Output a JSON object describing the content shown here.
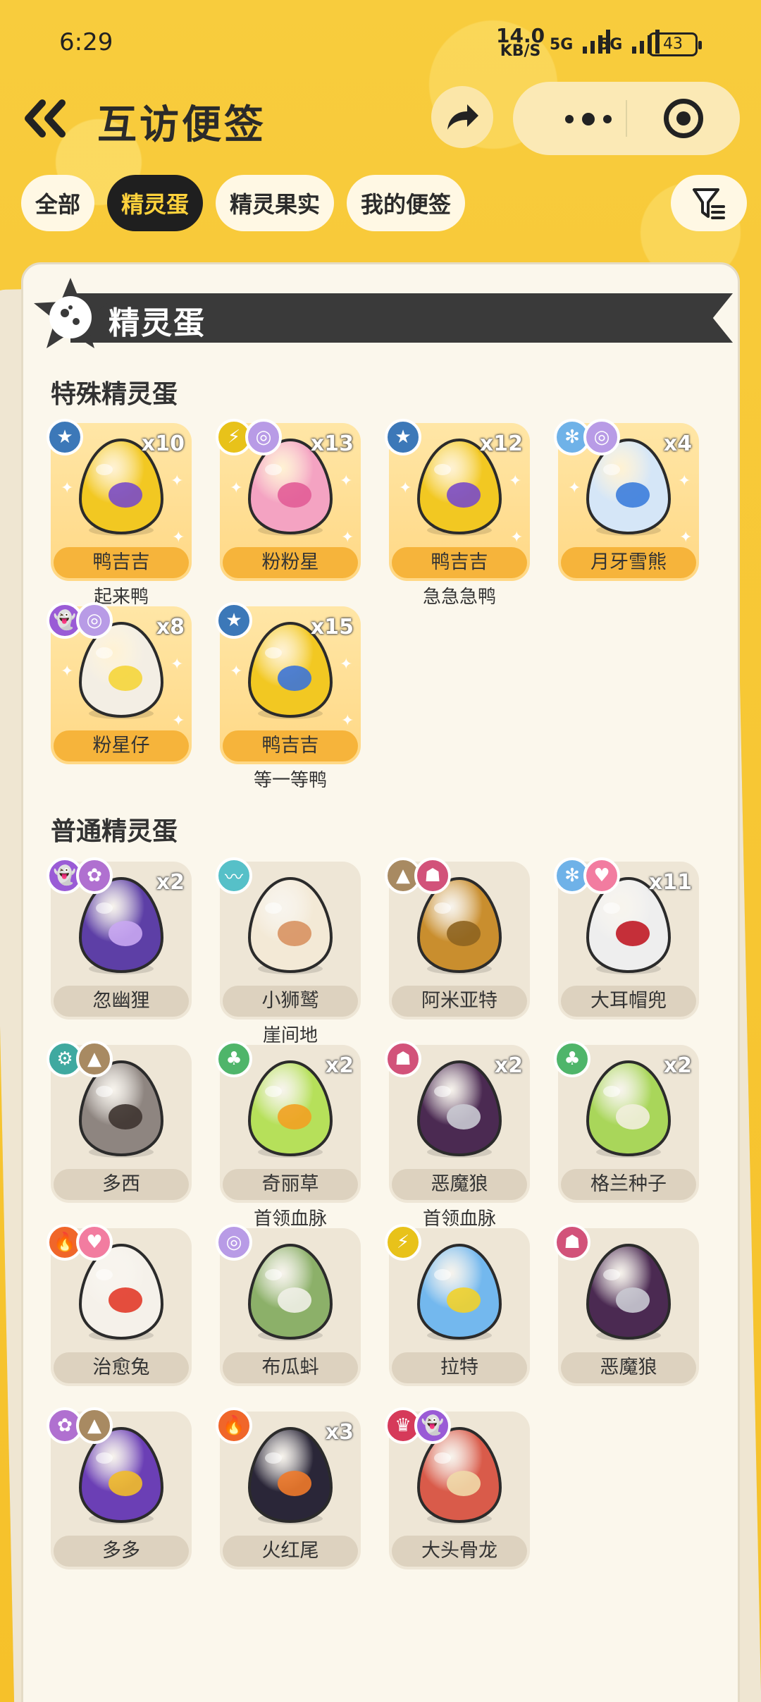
{
  "status": {
    "time": "6:29",
    "net_speed": "14.0",
    "net_unit": "KB/S",
    "sim1": "5G",
    "sim2": "5G",
    "battery": "43"
  },
  "header": {
    "title": "互访便签"
  },
  "tabs": [
    {
      "label": "全部"
    },
    {
      "label": "精灵蛋"
    },
    {
      "label": "精灵果实"
    },
    {
      "label": "我的便签"
    }
  ],
  "section": {
    "title": "精灵蛋"
  },
  "special": {
    "title": "特殊精灵蛋",
    "items": [
      {
        "name": "鸭吉吉",
        "count": "x10",
        "sub": "起来鸭",
        "egg_base": "#F2C822",
        "egg_accent": "#7A4BC8",
        "types": [
          "star"
        ]
      },
      {
        "name": "粉粉星",
        "count": "x13",
        "sub": "",
        "egg_base": "#F4A3C2",
        "egg_accent": "#E25D97",
        "types": [
          "electric",
          "wind"
        ]
      },
      {
        "name": "鸭吉吉",
        "count": "x12",
        "sub": "急急急鸭",
        "egg_base": "#F2C822",
        "egg_accent": "#7A4BC8",
        "types": [
          "star"
        ]
      },
      {
        "name": "月牙雪熊",
        "count": "x4",
        "sub": "",
        "egg_base": "#D5E6F7",
        "egg_accent": "#3C7DDB",
        "types": [
          "ice",
          "wind"
        ]
      },
      {
        "name": "粉星仔",
        "count": "x8",
        "sub": "",
        "egg_base": "#F3EEE4",
        "egg_accent": "#F5D53A",
        "types": [
          "ghost",
          "wind"
        ]
      },
      {
        "name": "鸭吉吉",
        "count": "x15",
        "sub": "等一等鸭",
        "egg_base": "#F2C822",
        "egg_accent": "#3C74D8",
        "types": [
          "star"
        ]
      }
    ]
  },
  "normal": {
    "title": "普通精灵蛋",
    "items": [
      {
        "name": "忽幽狸",
        "count": "x2",
        "sub": "",
        "egg_base": "#5D3FA6",
        "egg_accent": "#C9A7F2",
        "types": [
          "ghost",
          "fairy"
        ]
      },
      {
        "name": "小狮鹫",
        "count": "",
        "sub": "崖间地",
        "egg_base": "#F3E9D6",
        "egg_accent": "#D89262",
        "types": [
          "wing"
        ]
      },
      {
        "name": "阿米亚特",
        "count": "",
        "sub": "",
        "egg_base": "#C98E2E",
        "egg_accent": "#8E6420",
        "types": [
          "ground",
          "evil"
        ]
      },
      {
        "name": "大耳帽兜",
        "count": "x11",
        "sub": "",
        "egg_base": "#EEEEEE",
        "egg_accent": "#C01A25",
        "types": [
          "ice",
          "cute"
        ]
      },
      {
        "name": "多西",
        "count": "",
        "sub": "",
        "egg_base": "#8E8580",
        "egg_accent": "#3E3430",
        "types": [
          "machine",
          "ground"
        ]
      },
      {
        "name": "奇丽草",
        "count": "x2",
        "sub": "首领血脉",
        "egg_base": "#B6E05A",
        "egg_accent": "#F2A122",
        "types": [
          "grass"
        ]
      },
      {
        "name": "恶魔狼",
        "count": "x2",
        "sub": "首领血脉",
        "egg_base": "#4B2A52",
        "egg_accent": "#C9C9D2",
        "types": [
          "evil"
        ]
      },
      {
        "name": "格兰种子",
        "count": "x2",
        "sub": "",
        "egg_base": "#A9D65A",
        "egg_accent": "#F1EEDC",
        "types": [
          "grass"
        ]
      },
      {
        "name": "治愈兔",
        "count": "",
        "sub": "",
        "egg_base": "#F5F1EA",
        "egg_accent": "#E23B2A",
        "types": [
          "fire",
          "cute"
        ]
      },
      {
        "name": "布瓜蚪",
        "count": "",
        "sub": "",
        "egg_base": "#8CB069",
        "egg_accent": "#F0EFE7",
        "types": [
          "wind"
        ]
      },
      {
        "name": "拉特",
        "count": "",
        "sub": "",
        "egg_base": "#73B8EE",
        "egg_accent": "#F2D22A",
        "types": [
          "electric"
        ]
      },
      {
        "name": "恶魔狼",
        "count": "",
        "sub": "",
        "egg_base": "#4B2A52",
        "egg_accent": "#C9C9D2",
        "types": [
          "evil"
        ]
      },
      {
        "name": "多多",
        "count": "",
        "sub": "",
        "egg_base": "#6B3FB5",
        "egg_accent": "#F2BD2A",
        "types": [
          "fairy",
          "ground"
        ]
      },
      {
        "name": "火红尾",
        "count": "x3",
        "sub": "",
        "egg_base": "#2A2638",
        "egg_accent": "#F07A2A",
        "types": [
          "fire"
        ]
      },
      {
        "name": "大头骨龙",
        "count": "",
        "sub": "",
        "egg_base": "#D95B4A",
        "egg_accent": "#F0D9A8",
        "types": [
          "dragon",
          "ghost"
        ]
      }
    ]
  },
  "type_colors": {
    "star": "#3C78B8",
    "electric": "#E8C21A",
    "wind": "#B89BE6",
    "ice": "#6FB2E8",
    "ghost": "#9A5BD6",
    "fairy": "#B070D0",
    "wing": "#56C0C8",
    "ground": "#A88A62",
    "evil": "#D2527A",
    "cute": "#F27CA0",
    "machine": "#3FA9A0",
    "grass": "#4FB56A",
    "fire": "#F0662A",
    "dragon": "#D63A5A"
  }
}
